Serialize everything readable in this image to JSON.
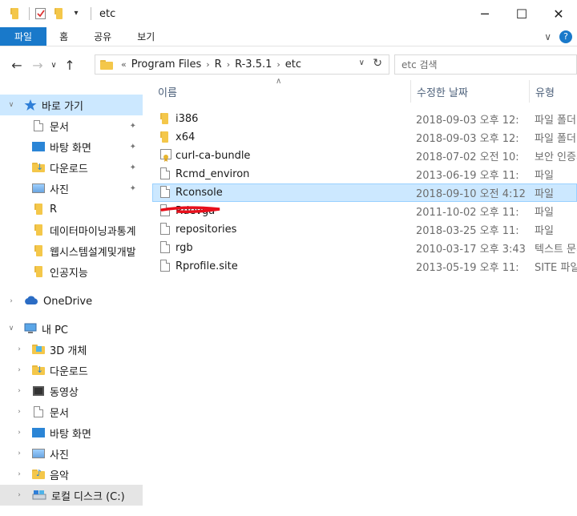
{
  "window": {
    "title": "etc",
    "controls": {
      "minimize": "─",
      "maximize": "☐",
      "close": "✕"
    },
    "qa_dropdown": "▾"
  },
  "ribbon": {
    "tabs": [
      "파일",
      "홈",
      "공유",
      "보기"
    ],
    "collapse": "∨",
    "help": "?"
  },
  "navigation": {
    "back": "←",
    "forward": "→",
    "recent": "∨",
    "up": "↑"
  },
  "address": {
    "overflow": "«",
    "breadcrumbs": [
      "Program Files",
      "R",
      "R-3.5.1",
      "etc"
    ],
    "separator": "›",
    "dropdown": "∨",
    "refresh": "↻"
  },
  "search": {
    "placeholder": "etc 검색"
  },
  "nav_pane": {
    "quick_access": "바로 가기",
    "quick_items": [
      {
        "label": "문서",
        "icon": "documents-icon",
        "pinned": true
      },
      {
        "label": "바탕 화면",
        "icon": "desktop-icon",
        "pinned": true
      },
      {
        "label": "다운로드",
        "icon": "downloads-icon",
        "pinned": true
      },
      {
        "label": "사진",
        "icon": "pictures-icon",
        "pinned": true
      },
      {
        "label": "R",
        "icon": "folder-icon",
        "pinned": false
      },
      {
        "label": "데이터마이닝과통계",
        "icon": "folder-icon",
        "pinned": false
      },
      {
        "label": "웹시스템설계및개발",
        "icon": "folder-icon",
        "pinned": false
      },
      {
        "label": "인공지능",
        "icon": "folder-icon",
        "pinned": false
      }
    ],
    "onedrive": "OneDrive",
    "this_pc": "내 PC",
    "pc_items": [
      {
        "label": "3D 개체",
        "icon": "3d-objects-icon"
      },
      {
        "label": "다운로드",
        "icon": "downloads-icon"
      },
      {
        "label": "동영상",
        "icon": "videos-icon"
      },
      {
        "label": "문서",
        "icon": "documents-icon"
      },
      {
        "label": "바탕 화면",
        "icon": "desktop-icon"
      },
      {
        "label": "사진",
        "icon": "pictures-icon"
      },
      {
        "label": "음악",
        "icon": "music-icon"
      },
      {
        "label": "로컬 디스크 (C:)",
        "icon": "local-disk-icon"
      }
    ],
    "pin_glyph": "✦"
  },
  "columns": {
    "name": "이름",
    "date": "수정한 날짜",
    "type": "유형",
    "sort_glyph": "∧"
  },
  "files": [
    {
      "name": "i386",
      "date": "2018-09-03 오후 12:",
      "type": "파일 폴더",
      "kind": "folder",
      "selected": false
    },
    {
      "name": "x64",
      "date": "2018-09-03 오후 12:",
      "type": "파일 폴더",
      "kind": "folder",
      "selected": false
    },
    {
      "name": "curl-ca-bundle",
      "date": "2018-07-02 오전 10:",
      "type": "보안 인증서",
      "kind": "cert",
      "selected": false
    },
    {
      "name": "Rcmd_environ",
      "date": "2013-06-19 오후 11:",
      "type": "파일",
      "kind": "file",
      "selected": false
    },
    {
      "name": "Rconsole",
      "date": "2018-09-10 오전 4:12",
      "type": "파일",
      "kind": "file",
      "selected": true
    },
    {
      "name": "Rdevga",
      "date": "2011-10-02 오후 11:",
      "type": "파일",
      "kind": "file",
      "selected": false
    },
    {
      "name": "repositories",
      "date": "2018-03-25 오후 11:",
      "type": "파일",
      "kind": "file",
      "selected": false
    },
    {
      "name": "rgb",
      "date": "2010-03-17 오후 3:43",
      "type": "텍스트 문서",
      "kind": "file",
      "selected": false
    },
    {
      "name": "Rprofile.site",
      "date": "2013-05-19 오후 11:",
      "type": "SITE 파일",
      "kind": "file",
      "selected": false
    }
  ],
  "colors": {
    "accent": "#1979ca",
    "selection": "#cce8ff",
    "annotation": "#e8101c"
  }
}
